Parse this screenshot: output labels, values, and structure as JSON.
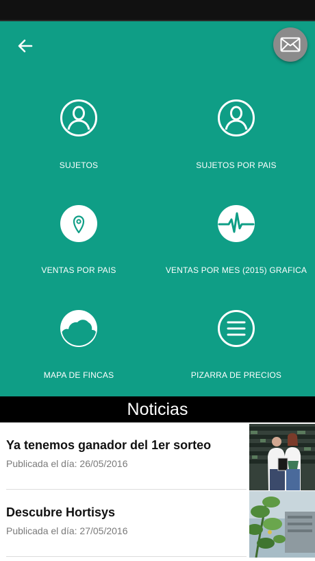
{
  "header": {
    "back_icon": "arrow-left-icon",
    "mail_icon": "envelope-icon"
  },
  "menu": {
    "items": [
      {
        "label": "SUJETOS",
        "icon": "user-circle-icon"
      },
      {
        "label": "SUJETOS POR PAIS",
        "icon": "user-circle-icon"
      },
      {
        "label": "VENTAS POR PAIS",
        "icon": "map-pin-icon"
      },
      {
        "label": "VENTAS POR MES (2015) GRAFICA",
        "icon": "pulse-icon"
      },
      {
        "label": "MAPA DE FINCAS",
        "icon": "cloud-icon"
      },
      {
        "label": "PIZARRA DE PRECIOS",
        "icon": "menu-lines-icon"
      }
    ]
  },
  "news": {
    "heading": "Noticias",
    "items": [
      {
        "title": "Ya tenemos ganador del 1er sorteo",
        "date": "Publicada el día: 26/05/2016"
      },
      {
        "title": "Descubre Hortisys",
        "date": "Publicada el día: 27/05/2016"
      }
    ]
  },
  "colors": {
    "primary": "#0f9e86",
    "mail_button": "#8b8b8b",
    "news_bar": "#000000"
  }
}
